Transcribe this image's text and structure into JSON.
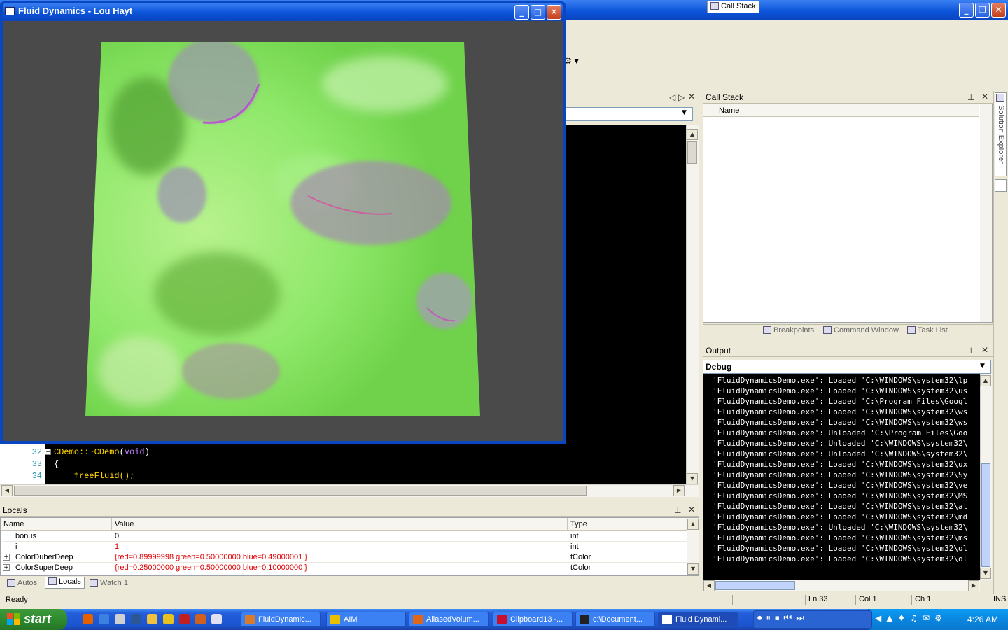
{
  "fluid_window": {
    "title": "Fluid Dynamics - Lou Hayt"
  },
  "ide": {
    "toolbar_glyph": "⚙ ▾"
  },
  "call_stack": {
    "title": "Call Stack",
    "column_name": "Name",
    "tabs": [
      "Call Stack",
      "Breakpoints",
      "Command Window",
      "Task List"
    ]
  },
  "editor": {
    "lines": [
      {
        "num": "32",
        "text_class": "CDemo::~CDemo",
        "paren_open": "(",
        "kw": "void",
        "paren_close": ")"
      },
      {
        "num": "33",
        "text": "{"
      },
      {
        "num": "34",
        "text": "    freeFluid();"
      }
    ]
  },
  "locals": {
    "title": "Locals",
    "columns": [
      "Name",
      "Value",
      "Type"
    ],
    "rows": [
      {
        "name": "bonus",
        "value": "0",
        "type": "int",
        "expandable": false,
        "changed": false
      },
      {
        "name": "i",
        "value": "1",
        "type": "int",
        "expandable": false,
        "changed": true
      },
      {
        "name": "ColorDuberDeep",
        "value": "{red=0.89999998 green=0.50000000 blue=0.49000001 }",
        "type": "tColor",
        "expandable": true,
        "changed": true
      },
      {
        "name": "ColorSuperDeep",
        "value": "{red=0.25000000 green=0.50000000 blue=0.10000000 }",
        "type": "tColor",
        "expandable": true,
        "changed": true
      }
    ],
    "tabs": [
      "Autos",
      "Locals",
      "Watch 1"
    ],
    "active_tab": "Locals"
  },
  "output": {
    "title": "Output",
    "selector": "Debug",
    "lines": [
      "'FluidDynamicsDemo.exe': Loaded 'C:\\WINDOWS\\system32\\lp",
      "'FluidDynamicsDemo.exe': Loaded 'C:\\WINDOWS\\system32\\us",
      "'FluidDynamicsDemo.exe': Loaded 'C:\\Program Files\\Googl",
      "'FluidDynamicsDemo.exe': Loaded 'C:\\WINDOWS\\system32\\ws",
      "'FluidDynamicsDemo.exe': Loaded 'C:\\WINDOWS\\system32\\ws",
      "'FluidDynamicsDemo.exe': Unloaded 'C:\\Program Files\\Goo",
      "'FluidDynamicsDemo.exe': Unloaded 'C:\\WINDOWS\\system32\\",
      "'FluidDynamicsDemo.exe': Unloaded 'C:\\WINDOWS\\system32\\",
      "'FluidDynamicsDemo.exe': Loaded 'C:\\WINDOWS\\system32\\ux",
      "'FluidDynamicsDemo.exe': Loaded 'C:\\WINDOWS\\system32\\Sy",
      "'FluidDynamicsDemo.exe': Loaded 'C:\\WINDOWS\\system32\\ve",
      "'FluidDynamicsDemo.exe': Loaded 'C:\\WINDOWS\\system32\\MS",
      "'FluidDynamicsDemo.exe': Loaded 'C:\\WINDOWS\\system32\\at",
      "'FluidDynamicsDemo.exe': Loaded 'C:\\WINDOWS\\system32\\md",
      "'FluidDynamicsDemo.exe': Unloaded 'C:\\WINDOWS\\system32\\",
      "'FluidDynamicsDemo.exe': Loaded 'C:\\WINDOWS\\system32\\ms",
      "'FluidDynamicsDemo.exe': Loaded 'C:\\WINDOWS\\system32\\ol",
      "'FluidDynamicsDemo.exe': Loaded 'C:\\WINDOWS\\system32\\ol"
    ]
  },
  "solution_explorer": {
    "label": "Solution Explorer"
  },
  "status": {
    "text": "Ready",
    "ln": "Ln 33",
    "col": "Col 1",
    "ch": "Ch 1",
    "mode": "INS"
  },
  "taskbar": {
    "start": "start",
    "buttons": [
      {
        "label": "FluidDynamic...",
        "icon_color": "#d97b2b"
      },
      {
        "label": "AIM",
        "icon_color": "#e8c000"
      },
      {
        "label": "AliasedVolum...",
        "icon_color": "#e0661a"
      },
      {
        "label": "Clipboard13 -...",
        "icon_color": "#c8102e"
      },
      {
        "label": "c:\\Document...",
        "icon_color": "#222222"
      },
      {
        "label": "Fluid Dynami...",
        "icon_color": "#ffffff"
      }
    ],
    "active_button": "Fluid Dynami...",
    "clock": "4:26 AM"
  },
  "colors": {
    "xp_blue": "#0b53d8",
    "changed_value": "#e00000",
    "fluid_green": "#7ee85a"
  }
}
